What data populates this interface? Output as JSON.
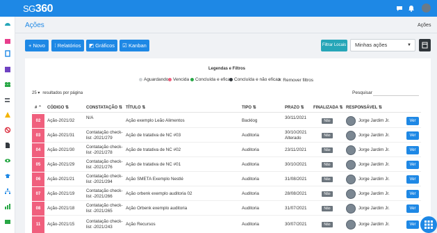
{
  "app": {
    "logo_small": "SG",
    "logo_big": "360"
  },
  "page": {
    "title": "Ações",
    "breadcrumb": "Ações"
  },
  "toolbar": {
    "new_label": "+ Novo",
    "reports_label": "Relatórios",
    "charts_label": "Gráficos",
    "kanban_label": "Kanban",
    "filter_locals_label": "Filtrar Locais",
    "view_select_value": "Minhas ações"
  },
  "legend": {
    "title": "Legendas e Filtros",
    "items": [
      {
        "label": "Aguardando",
        "color": "#cfd3d6"
      },
      {
        "label": "Vencida",
        "color": "#f05f7d"
      },
      {
        "label": "Concluída e eficaz",
        "color": "#28a745"
      },
      {
        "label": "Concluída e não eficaz",
        "color": "#2f353a"
      },
      {
        "label": "Remover filtros",
        "icon": "close-icon"
      }
    ]
  },
  "table_controls": {
    "per_page_value": "25",
    "per_page_suffix": "resultados por página",
    "search_label": "Pesquisar"
  },
  "columns": [
    "#",
    "CÓDIGO",
    "CONSTATAÇÃO",
    "TÍTULO",
    "TIPO",
    "PRAZO",
    "FINALIZADA",
    "RESPONSÁVEL"
  ],
  "rows": [
    {
      "num": "02",
      "code": "Ação-2021/32",
      "finding_1": "N/A",
      "finding_2": "",
      "title": "Ação exemplo Leão Alimentos",
      "type": "Backlog",
      "deadline_1": "30/11/2021",
      "deadline_2": "",
      "finished": "Não",
      "owner": "Jorge Jardim Jr.",
      "action": "Ver"
    },
    {
      "num": "03",
      "code": "Ação-2021/31",
      "finding_1": "Contatação check-",
      "finding_2": "list -2021/279",
      "title": "Ação de tratativa de NC #03",
      "type": "Auditoria",
      "deadline_1": "30/10/2021",
      "deadline_2": "Alterado",
      "finished": "Não",
      "owner": "Jorge Jardim Jr.",
      "action": "Ver"
    },
    {
      "num": "04",
      "code": "Ação-2021/30",
      "finding_1": "Contatação check-",
      "finding_2": "list -2021/278",
      "title": "Ação de tratativa de NC #02",
      "type": "Auditoria",
      "deadline_1": "23/11/2021",
      "deadline_2": "",
      "finished": "Não",
      "owner": "Jorge Jardim Jr.",
      "action": "Ver"
    },
    {
      "num": "05",
      "code": "Ação-2021/29",
      "finding_1": "Contatação check-",
      "finding_2": "list -2021/276",
      "title": "Ação de tratativa de NC #01",
      "type": "Auditoria",
      "deadline_1": "30/10/2021",
      "deadline_2": "",
      "finished": "Não",
      "owner": "Jorge Jardim Jr.",
      "action": "Ver"
    },
    {
      "num": "06",
      "code": "Ação-2021/21",
      "finding_1": "Contatação check-",
      "finding_2": "list -2021/294",
      "title": "Ação SMETA Exemplo Nestlé",
      "type": "Auditoria",
      "deadline_1": "31/08/2021",
      "deadline_2": "",
      "finished": "Não",
      "owner": "Jorge Jardim Jr.",
      "action": "Ver"
    },
    {
      "num": "07",
      "code": "Ação-2021/19",
      "finding_1": "Contatação check-",
      "finding_2": "list -2021/266",
      "title": "Ação orbenk exemplo auditoria 02",
      "type": "Auditoria",
      "deadline_1": "28/08/2021",
      "deadline_2": "",
      "finished": "Não",
      "owner": "Jorge Jardim Jr.",
      "action": "Ver"
    },
    {
      "num": "08",
      "code": "Ação-2021/18",
      "finding_1": "Contatação check-",
      "finding_2": "list -2021/265",
      "title": "Ação Orbenk exemplo auditoria",
      "type": "Auditoria",
      "deadline_1": "31/07/2021",
      "deadline_2": "",
      "finished": "Não",
      "owner": "Jorge Jardim Jr.",
      "action": "Ver"
    },
    {
      "num": "11",
      "code": "Ação-2021/15",
      "finding_1": "Contatação check-",
      "finding_2": "list -2021/243",
      "title": "Ação Recursos",
      "type": "Auditoria",
      "deadline_1": "30/07/2021",
      "deadline_2": "",
      "finished": "Não",
      "owner": "Jorge Jardim Jr.",
      "action": "Ver"
    }
  ],
  "colors": {
    "primary": "#1e88e5",
    "overdue": "#f05f7d",
    "teal": "#26a6b8",
    "dark": "#2f353a"
  }
}
